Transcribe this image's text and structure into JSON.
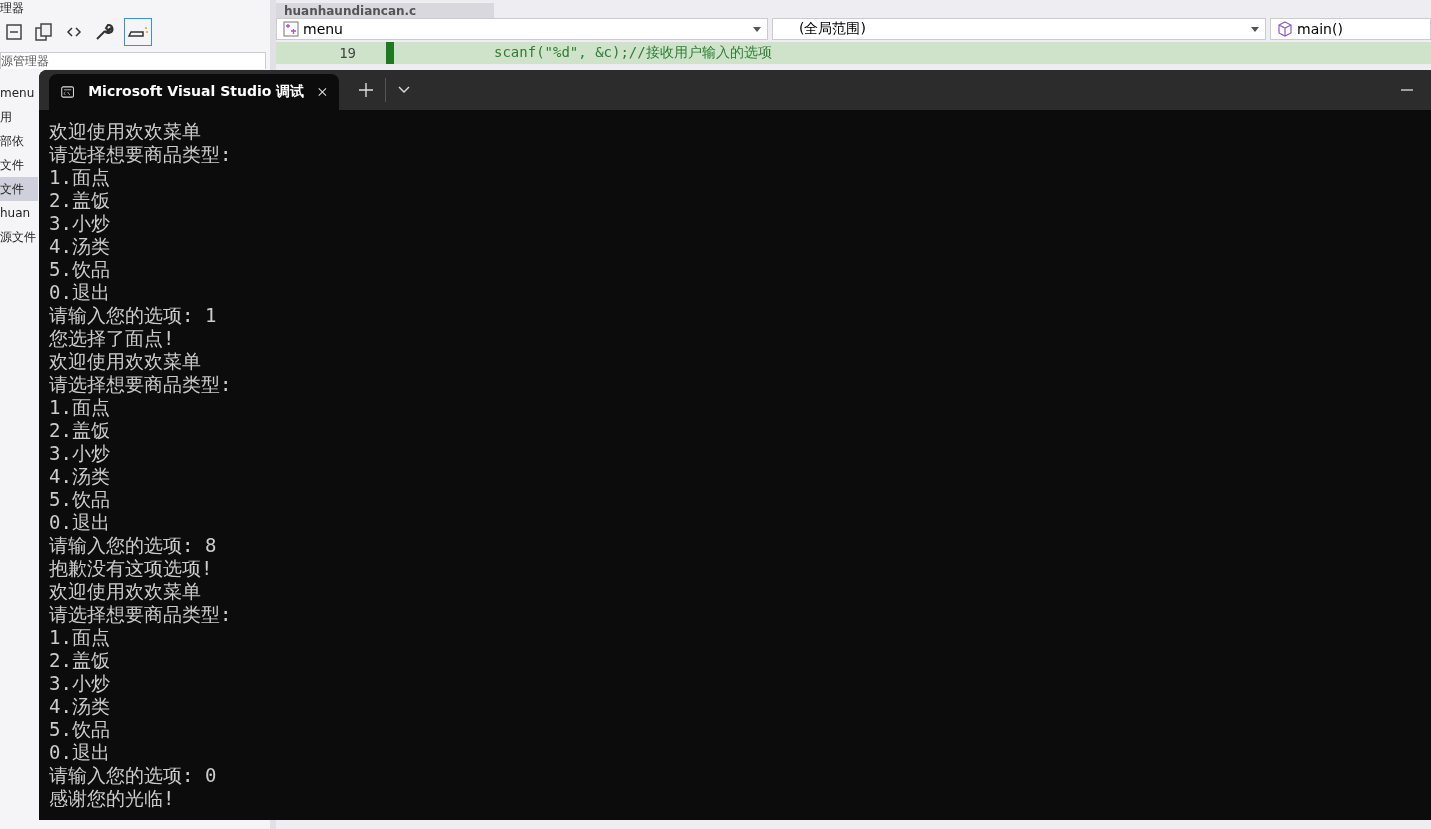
{
  "ide": {
    "panel_title": "理器",
    "explorer_search": {
      "placeholder": "源管理器"
    },
    "sidebar": {
      "items": [
        {
          "label": "menu",
          "selected": false
        },
        {
          "label": "用",
          "selected": false
        },
        {
          "label": "部依",
          "selected": false
        },
        {
          "label": "文件",
          "selected": false
        },
        {
          "label": "文件",
          "selected": true
        },
        {
          "label": "huan",
          "selected": false
        },
        {
          "label": "源文件",
          "selected": false
        }
      ]
    },
    "editor_tab": {
      "title": "huanhaundiancan.c"
    },
    "nav": {
      "project": "menu",
      "scope": "(全局范围)",
      "member": "main()"
    },
    "code": {
      "line_number": "19",
      "text": "scanf(\"%d\", &c);//接收用户输入的选项"
    }
  },
  "console": {
    "tab_title": "Microsoft Visual Studio 调试",
    "lines": [
      "欢迎使用欢欢菜单",
      "请选择想要商品类型:",
      "1.面点",
      "2.盖饭",
      "3.小炒",
      "4.汤类",
      "5.饮品",
      "0.退出",
      "请输入您的选项: 1",
      "您选择了面点!",
      "欢迎使用欢欢菜单",
      "请选择想要商品类型:",
      "1.面点",
      "2.盖饭",
      "3.小炒",
      "4.汤类",
      "5.饮品",
      "0.退出",
      "请输入您的选项: 8",
      "抱歉没有这项选项!",
      "欢迎使用欢欢菜单",
      "请选择想要商品类型:",
      "1.面点",
      "2.盖饭",
      "3.小炒",
      "4.汤类",
      "5.饮品",
      "0.退出",
      "请输入您的选项: 0",
      "感谢您的光临!"
    ]
  }
}
